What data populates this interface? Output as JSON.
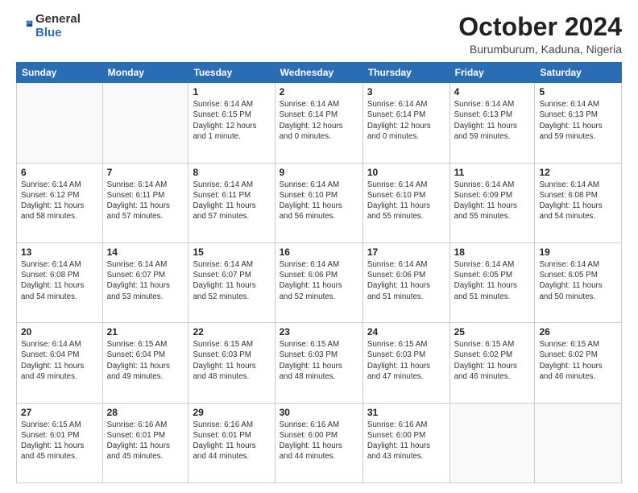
{
  "header": {
    "logo": {
      "line1": "General",
      "line2": "Blue"
    },
    "title": "October 2024",
    "location": "Burumburum, Kaduna, Nigeria"
  },
  "weekdays": [
    "Sunday",
    "Monday",
    "Tuesday",
    "Wednesday",
    "Thursday",
    "Friday",
    "Saturday"
  ],
  "weeks": [
    [
      {
        "day": "",
        "info": ""
      },
      {
        "day": "",
        "info": ""
      },
      {
        "day": "1",
        "info": "Sunrise: 6:14 AM\nSunset: 6:15 PM\nDaylight: 12 hours\nand 1 minute."
      },
      {
        "day": "2",
        "info": "Sunrise: 6:14 AM\nSunset: 6:14 PM\nDaylight: 12 hours\nand 0 minutes."
      },
      {
        "day": "3",
        "info": "Sunrise: 6:14 AM\nSunset: 6:14 PM\nDaylight: 12 hours\nand 0 minutes."
      },
      {
        "day": "4",
        "info": "Sunrise: 6:14 AM\nSunset: 6:13 PM\nDaylight: 11 hours\nand 59 minutes."
      },
      {
        "day": "5",
        "info": "Sunrise: 6:14 AM\nSunset: 6:13 PM\nDaylight: 11 hours\nand 59 minutes."
      }
    ],
    [
      {
        "day": "6",
        "info": "Sunrise: 6:14 AM\nSunset: 6:12 PM\nDaylight: 11 hours\nand 58 minutes."
      },
      {
        "day": "7",
        "info": "Sunrise: 6:14 AM\nSunset: 6:11 PM\nDaylight: 11 hours\nand 57 minutes."
      },
      {
        "day": "8",
        "info": "Sunrise: 6:14 AM\nSunset: 6:11 PM\nDaylight: 11 hours\nand 57 minutes."
      },
      {
        "day": "9",
        "info": "Sunrise: 6:14 AM\nSunset: 6:10 PM\nDaylight: 11 hours\nand 56 minutes."
      },
      {
        "day": "10",
        "info": "Sunrise: 6:14 AM\nSunset: 6:10 PM\nDaylight: 11 hours\nand 55 minutes."
      },
      {
        "day": "11",
        "info": "Sunrise: 6:14 AM\nSunset: 6:09 PM\nDaylight: 11 hours\nand 55 minutes."
      },
      {
        "day": "12",
        "info": "Sunrise: 6:14 AM\nSunset: 6:08 PM\nDaylight: 11 hours\nand 54 minutes."
      }
    ],
    [
      {
        "day": "13",
        "info": "Sunrise: 6:14 AM\nSunset: 6:08 PM\nDaylight: 11 hours\nand 54 minutes."
      },
      {
        "day": "14",
        "info": "Sunrise: 6:14 AM\nSunset: 6:07 PM\nDaylight: 11 hours\nand 53 minutes."
      },
      {
        "day": "15",
        "info": "Sunrise: 6:14 AM\nSunset: 6:07 PM\nDaylight: 11 hours\nand 52 minutes."
      },
      {
        "day": "16",
        "info": "Sunrise: 6:14 AM\nSunset: 6:06 PM\nDaylight: 11 hours\nand 52 minutes."
      },
      {
        "day": "17",
        "info": "Sunrise: 6:14 AM\nSunset: 6:06 PM\nDaylight: 11 hours\nand 51 minutes."
      },
      {
        "day": "18",
        "info": "Sunrise: 6:14 AM\nSunset: 6:05 PM\nDaylight: 11 hours\nand 51 minutes."
      },
      {
        "day": "19",
        "info": "Sunrise: 6:14 AM\nSunset: 6:05 PM\nDaylight: 11 hours\nand 50 minutes."
      }
    ],
    [
      {
        "day": "20",
        "info": "Sunrise: 6:14 AM\nSunset: 6:04 PM\nDaylight: 11 hours\nand 49 minutes."
      },
      {
        "day": "21",
        "info": "Sunrise: 6:15 AM\nSunset: 6:04 PM\nDaylight: 11 hours\nand 49 minutes."
      },
      {
        "day": "22",
        "info": "Sunrise: 6:15 AM\nSunset: 6:03 PM\nDaylight: 11 hours\nand 48 minutes."
      },
      {
        "day": "23",
        "info": "Sunrise: 6:15 AM\nSunset: 6:03 PM\nDaylight: 11 hours\nand 48 minutes."
      },
      {
        "day": "24",
        "info": "Sunrise: 6:15 AM\nSunset: 6:03 PM\nDaylight: 11 hours\nand 47 minutes."
      },
      {
        "day": "25",
        "info": "Sunrise: 6:15 AM\nSunset: 6:02 PM\nDaylight: 11 hours\nand 46 minutes."
      },
      {
        "day": "26",
        "info": "Sunrise: 6:15 AM\nSunset: 6:02 PM\nDaylight: 11 hours\nand 46 minutes."
      }
    ],
    [
      {
        "day": "27",
        "info": "Sunrise: 6:15 AM\nSunset: 6:01 PM\nDaylight: 11 hours\nand 45 minutes."
      },
      {
        "day": "28",
        "info": "Sunrise: 6:16 AM\nSunset: 6:01 PM\nDaylight: 11 hours\nand 45 minutes."
      },
      {
        "day": "29",
        "info": "Sunrise: 6:16 AM\nSunset: 6:01 PM\nDaylight: 11 hours\nand 44 minutes."
      },
      {
        "day": "30",
        "info": "Sunrise: 6:16 AM\nSunset: 6:00 PM\nDaylight: 11 hours\nand 44 minutes."
      },
      {
        "day": "31",
        "info": "Sunrise: 6:16 AM\nSunset: 6:00 PM\nDaylight: 11 hours\nand 43 minutes."
      },
      {
        "day": "",
        "info": ""
      },
      {
        "day": "",
        "info": ""
      }
    ]
  ]
}
